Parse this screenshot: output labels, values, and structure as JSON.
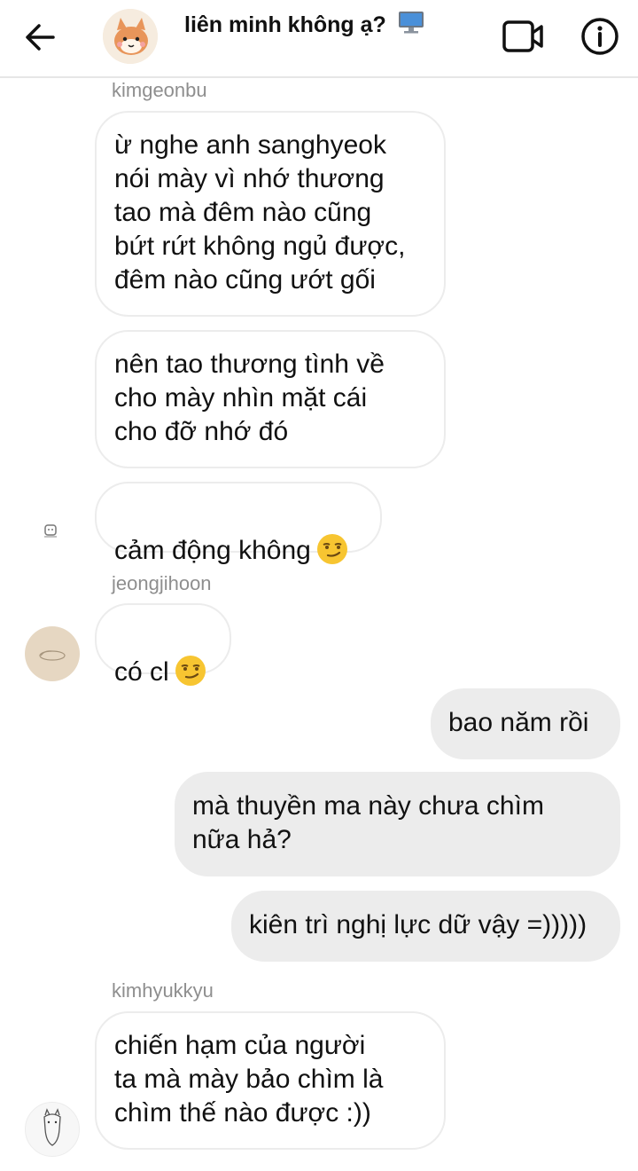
{
  "header": {
    "title": "liên minh không ạ?",
    "title_icon": "desktop-computer-icon",
    "back_icon": "arrow-left-icon",
    "video_icon": "video-camera-icon",
    "info_icon": "info-icon"
  },
  "messages": [
    {
      "sender": "kimgeonbu",
      "text": "ừ nghe anh sanghyeok\nnói mày vì nhớ thương\ntao mà đêm nào cũng\nbứt rứt không ngủ được,\nđêm nào cũng ướt gối"
    },
    {
      "text": "nên tao thương tình về\ncho mày nhìn mặt cái\ncho đỡ nhớ đó"
    },
    {
      "text": "cảm động không",
      "emoji": "smirking-face-emoji"
    },
    {
      "sender": "jeongjihoon",
      "text": "có cl",
      "emoji": "smirking-face-emoji"
    },
    {
      "text": "bao năm rồi"
    },
    {
      "text": "mà thuyền ma này chưa chìm\nnữa hả?"
    },
    {
      "text": "kiên trì nghị lực dữ vậy =)))))"
    },
    {
      "sender": "kimhyukkyu",
      "text": "chiến hạm của người\nta mà mày bảo chìm là\nchìm thế nào được :))"
    }
  ],
  "colors": {
    "incoming_bubble_border": "#ececec",
    "outgoing_bubble_bg": "#ececec",
    "sender_label": "#8e8e8e"
  }
}
